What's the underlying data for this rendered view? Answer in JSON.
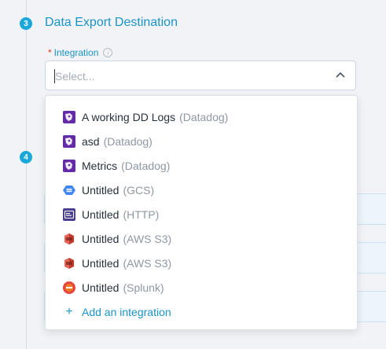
{
  "steps": [
    {
      "number": "3",
      "title": "Data Export Destination"
    },
    {
      "number": "4"
    }
  ],
  "field": {
    "required_marker": "*",
    "label": "Integration",
    "placeholder": "Select..."
  },
  "dropdown": {
    "options": [
      {
        "name": "A working DD Logs",
        "type": "(Datadog)",
        "icon": "datadog-icon"
      },
      {
        "name": "asd",
        "type": "(Datadog)",
        "icon": "datadog-icon"
      },
      {
        "name": "Metrics",
        "type": "(Datadog)",
        "icon": "datadog-icon"
      },
      {
        "name": "Untitled",
        "type": "(GCS)",
        "icon": "gcs-icon"
      },
      {
        "name": "Untitled",
        "type": "(HTTP)",
        "icon": "http-icon"
      },
      {
        "name": "Untitled",
        "type": "(AWS S3)",
        "icon": "aws-s3-icon"
      },
      {
        "name": "Untitled",
        "type": "(AWS S3)",
        "icon": "aws-s3-icon"
      },
      {
        "name": "Untitled",
        "type": "(Splunk)",
        "icon": "splunk-icon"
      }
    ],
    "add_label": "Add an integration"
  },
  "colors": {
    "accent": "#1a93c8",
    "badge": "#1aa7d9",
    "required": "#e0392b",
    "datadog": "#632ca6",
    "gcs": "#4285f4",
    "aws_s3": "#c0392b",
    "splunk": "#e8463c"
  }
}
